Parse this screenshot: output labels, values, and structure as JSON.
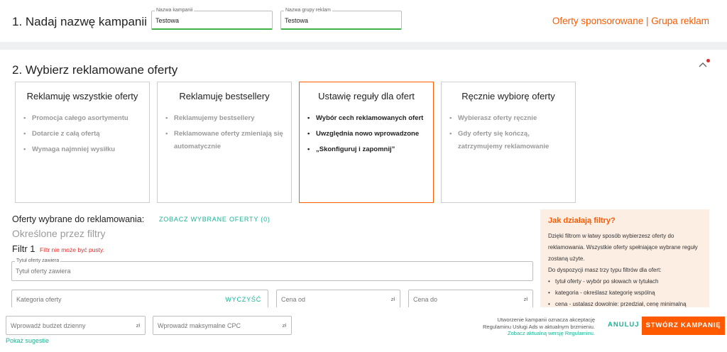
{
  "step1": {
    "title": "1. Nadaj nazwę kampanii",
    "campaign_name_label": "Nazwa kampanii",
    "campaign_name_value": "Testowa",
    "ad_group_label": "Nazwa grupy reklam",
    "ad_group_value": "Testowa",
    "header_link": "Oferty sponsorowane | Grupa reklam"
  },
  "step2": {
    "title": "2. Wybierz reklamowane oferty",
    "options": [
      {
        "title": "Reklamuję wszystkie oferty",
        "bullets": [
          "Promocja całego asortymentu",
          "Dotarcie z całą ofertą",
          "Wymaga najmniej wysiłku"
        ]
      },
      {
        "title": "Reklamuję bestsellery",
        "bullets": [
          "Reklamujemy bestsellery",
          "Reklamowane oferty zmieniają się automatycznie"
        ]
      },
      {
        "title": "Ustawię reguły dla ofert",
        "bullets": [
          "Wybór cech reklamowanych ofert",
          "Uwzględnia nowo wprowadzone",
          "„Skonfiguruj i zapomnij”"
        ]
      },
      {
        "title": "Ręcznie wybiorę oferty",
        "bullets": [
          "Wybierasz oferty ręcznie",
          "Gdy oferty się kończą, zatrzymujemy reklamowanie"
        ]
      }
    ],
    "selected_label": "Oferty wybrane do reklamowania:",
    "selected_link": "ZOBACZ WYBRANE OFERTY (0)",
    "filters_subtitle": "Określone przez filtry",
    "filter_heading": "Filtr 1",
    "filter_error": "Filtr nie może być pusty.",
    "title_field_label": "Tytuł oferty zawiera",
    "title_field_placeholder": "Tytuł oferty zawiera",
    "category_placeholder": "Kategoria oferty",
    "clear_label": "WYCZYŚĆ",
    "price_from_placeholder": "Cena od",
    "price_to_placeholder": "Cena do",
    "currency": "zł"
  },
  "help": {
    "title": "Jak działają filtry?",
    "text": "Dzięki filtrom w łatwy sposób wybierzesz oferty do reklamowania. Wszystkie oferty spełniające wybrane reguły zostaną użyte.",
    "text2": "Do dyspozycji masz trzy typu filtrów dla ofert:",
    "items": [
      "tytuł oferty - wybór po słowach w tytułach",
      "kategoria - określasz kategorię wspólną",
      "cena - ustalasz dowolnie: przedział, cenę minimalną"
    ]
  },
  "bottom": {
    "daily_budget_placeholder": "Wprowadź budżet dzienny",
    "max_cpc_placeholder": "Wprowadź maksymalne CPC",
    "currency": "zł",
    "suggestions_link": "Pokaż sugestie",
    "terms_line1": "Utworzenie kampanii oznacza akceptację",
    "terms_line2": "Regulaminu Usługi Ads w aktualnym brzmieniu.",
    "terms_link": "Zobacz aktualną wersję Regulaminu.",
    "cancel": "ANULUJ",
    "create": "STWÓRZ KAMPANIĘ"
  },
  "colors": {
    "accent": "#ff5a00",
    "link": "#1ab394",
    "error": "#e12b2b",
    "valid": "#43b047",
    "help_bg": "#fdeee4"
  },
  "icons": {
    "collapse": "chevron-up-icon",
    "notification": "red-dot-icon"
  }
}
